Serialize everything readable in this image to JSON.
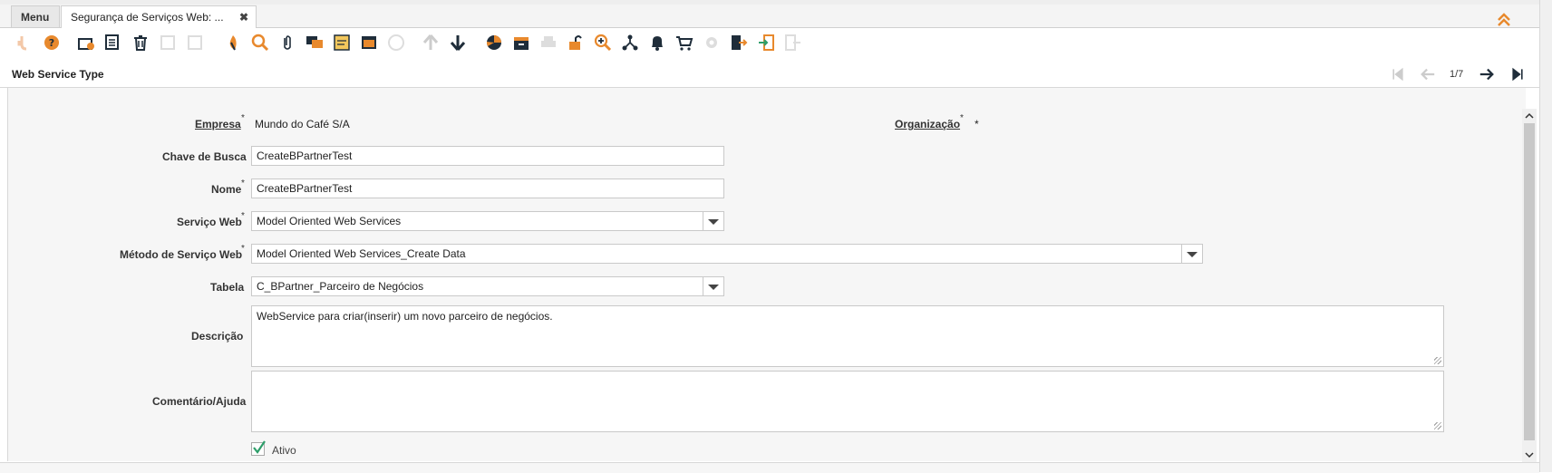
{
  "tabs": {
    "menu_label": "Menu",
    "active_label": "Segurança de Serviços Web: ...",
    "close_icon": "✖"
  },
  "toolbar": {
    "icons": [
      "undo-icon",
      "help-icon",
      "new-icon",
      "copy-icon",
      "delete-icon",
      "save-new-icon",
      "save-icon",
      "refresh-icon",
      "find-icon",
      "attachment-icon",
      "chat-icon",
      "postit-icon",
      "history-icon",
      "product-info-icon",
      "previous-record-icon",
      "next-record-icon",
      "report-icon",
      "archive-icon",
      "print-icon",
      "lock-icon",
      "zoom-across-icon",
      "workflow-icon",
      "notification-icon",
      "cart-icon",
      "settings-icon",
      "export-icon",
      "import-icon",
      "logout-icon"
    ]
  },
  "window": {
    "title": "Web Service Type",
    "pager": "1/7"
  },
  "form": {
    "empresa_label": "Empresa",
    "empresa_value": "Mundo do Café S/A",
    "organizacao_label": "Organização",
    "organizacao_value": "*",
    "chave_label": "Chave de Busca",
    "chave_value": "CreateBPartnerTest",
    "nome_label": "Nome",
    "nome_value": "CreateBPartnerTest",
    "servico_label": "Serviço Web",
    "servico_value": "Model Oriented Web Services",
    "metodo_label": "Método de Serviço Web",
    "metodo_value": "Model Oriented Web Services_Create Data",
    "tabela_label": "Tabela",
    "tabela_value": "C_BPartner_Parceiro de Negócios",
    "descricao_label": "Descrição",
    "descricao_value": "WebService para criar(inserir) um novo parceiro de negócios.",
    "comentario_label": "Comentário/Ajuda",
    "comentario_value": "",
    "ativo_label": "Ativo",
    "ativo_checked": true,
    "required_mark": "*"
  },
  "colors": {
    "accent": "#e8892d",
    "dark_icon": "#1f2d3a",
    "checkmark": "#2e9e6a"
  }
}
